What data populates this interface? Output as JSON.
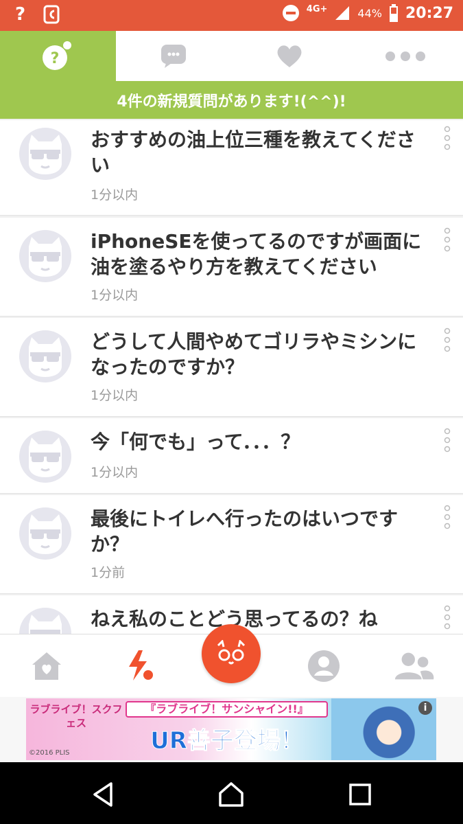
{
  "status_bar": {
    "question_icon": "?",
    "network": "4G+",
    "battery": "44%",
    "time": "20:27"
  },
  "tabs": [
    {
      "icon": "question-icon",
      "active": true
    },
    {
      "icon": "chat-icon",
      "active": false
    },
    {
      "icon": "heart-icon",
      "active": false
    },
    {
      "icon": "more-icon",
      "active": false
    }
  ],
  "banner": {
    "text": "4件の新規質問があります!(^^)!"
  },
  "questions": [
    {
      "text": "おすすめの油上位三種を教えてください",
      "time": "1分以内"
    },
    {
      "text": "iPhoneSEを使ってるのですが画面に油を塗るやり方を教えてください",
      "time": "1分以内"
    },
    {
      "text": "どうして人間やめてゴリラやミシンになったのですか？",
      "time": "1分以内"
    },
    {
      "text": "今「何でも」って．．．？",
      "time": "1分以内"
    },
    {
      "text": "最後にトイレへ行ったのはいつですか？",
      "time": "1分前"
    },
    {
      "text": "ねえ私のことどう思ってるの？ね",
      "time": ""
    }
  ],
  "bottom_nav": [
    "home-icon",
    "activity-icon",
    "ask-icon",
    "profile-icon",
    "friends-icon"
  ],
  "ad": {
    "logo": "ラブライブ！スクフェス",
    "title": "『ラブライブ！サンシャイン!!』",
    "main": "UR善子登場！",
    "copyright": "©2016 PLIS",
    "info": "i"
  },
  "colors": {
    "accent_green": "#9fc74f",
    "status_orange": "#e4583a",
    "fab_red": "#f0522e"
  }
}
